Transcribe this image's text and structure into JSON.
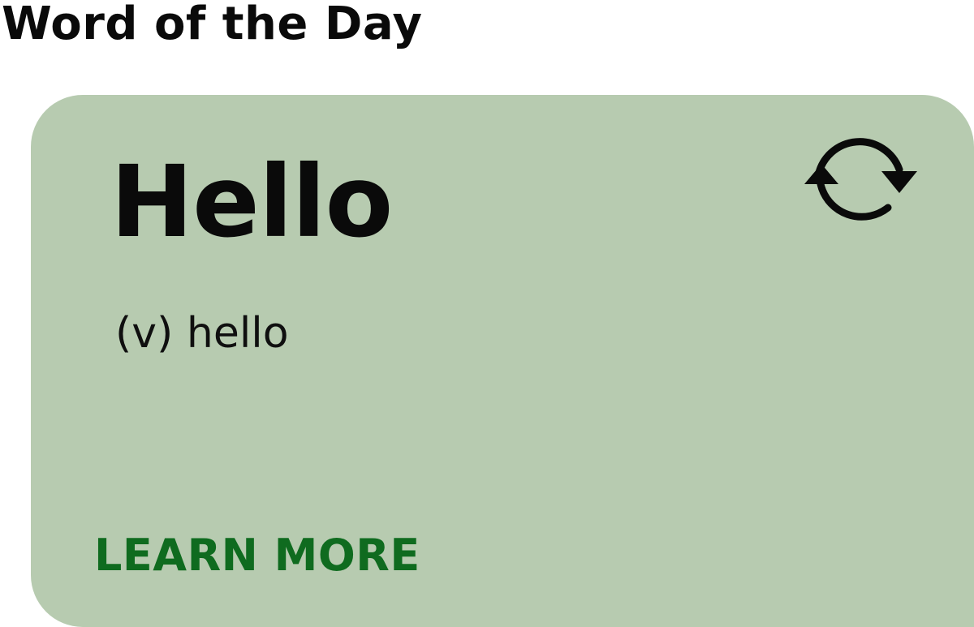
{
  "header": {
    "title": "Word of the Day"
  },
  "card": {
    "word": "Hello",
    "definition": "(v) hello",
    "learn_more_label": "LEARN MORE",
    "refresh_icon": "refresh-icon"
  },
  "colors": {
    "card_background": "#b7cbb0",
    "link": "#0f6b1f",
    "text": "#0a0a0a"
  }
}
